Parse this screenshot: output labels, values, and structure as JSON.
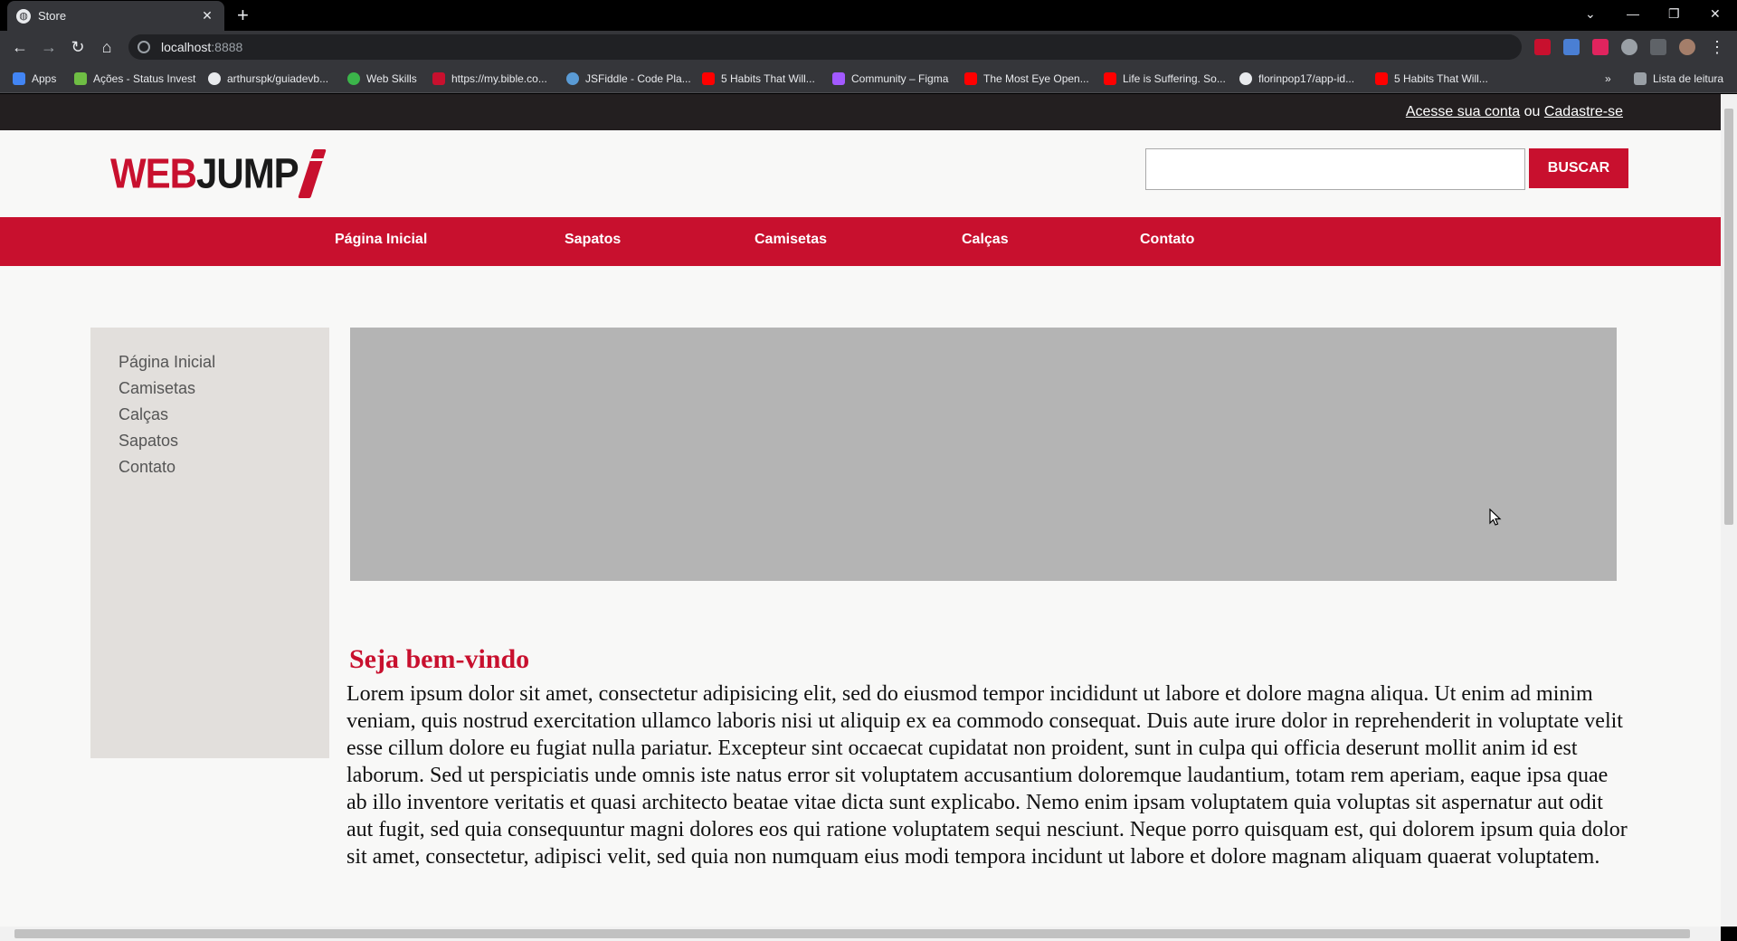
{
  "browser": {
    "tab_title": "Store",
    "url_host": "localhost",
    "url_port": ":8888",
    "bookmarks": [
      {
        "label": "Apps",
        "color": "#4285f4"
      },
      {
        "label": "Ações - Status Invest",
        "color": "#6fbe44"
      },
      {
        "label": "arthurspk/guiadevb...",
        "color": "#e8eaed"
      },
      {
        "label": "Web Skills",
        "color": "#3bb54a"
      },
      {
        "label": "https://my.bible.co...",
        "color": "#c8102e"
      },
      {
        "label": "JSFiddle - Code Pla...",
        "color": "#5a9bd5"
      },
      {
        "label": "5 Habits That Will...",
        "color": "#ff0000"
      },
      {
        "label": "Community – Figma",
        "color": "#a259ff"
      },
      {
        "label": "The Most Eye Open...",
        "color": "#ff0000"
      },
      {
        "label": "Life is Suffering. So...",
        "color": "#ff0000"
      },
      {
        "label": "florinpop17/app-id...",
        "color": "#e8eaed"
      },
      {
        "label": "5 Habits That Will...",
        "color": "#ff0000"
      }
    ],
    "overflow": "»",
    "reading_list": "Lista de leitura"
  },
  "page": {
    "account_link": "Acesse sua conta",
    "or_text": "ou",
    "signup_link": "Cadastre-se",
    "logo_web": "WEB",
    "logo_jump": "JUMP",
    "search_placeholder": "",
    "search_button": "BUSCAR",
    "nav": [
      "Página Inicial",
      "Sapatos",
      "Camisetas",
      "Calças",
      "Contato"
    ],
    "sidebar": [
      "Página Inicial",
      "Camisetas",
      "Calças",
      "Sapatos",
      "Contato"
    ],
    "welcome_title": "Seja bem-vindo",
    "welcome_text": "Lorem ipsum dolor sit amet, consectetur adipisicing elit, sed do eiusmod tempor incididunt ut labore et dolore magna aliqua. Ut enim ad minim veniam, quis nostrud exercitation ullamco laboris nisi ut aliquip ex ea commodo consequat. Duis aute irure dolor in reprehenderit in voluptate velit esse cillum dolore eu fugiat nulla pariatur. Excepteur sint occaecat cupidatat non proident, sunt in culpa qui officia deserunt mollit anim id est laborum. Sed ut perspiciatis unde omnis iste natus error sit voluptatem accusantium doloremque laudantium, totam rem aperiam, eaque ipsa quae ab illo inventore veritatis et quasi architecto beatae vitae dicta sunt explicabo. Nemo enim ipsam voluptatem quia voluptas sit aspernatur aut odit aut fugit, sed quia consequuntur magni dolores eos qui ratione voluptatem sequi nesciunt. Neque porro quisquam est, qui dolorem ipsum quia dolor sit amet, consectetur, adipisci velit, sed quia non numquam eius modi tempora incidunt ut labore et dolore magnam aliquam quaerat voluptatem."
  },
  "colors": {
    "brand_red": "#c8102e",
    "top_bar": "#231f20",
    "sidebar_bg": "#e2dfdc",
    "banner_bg": "#b4b4b4"
  }
}
